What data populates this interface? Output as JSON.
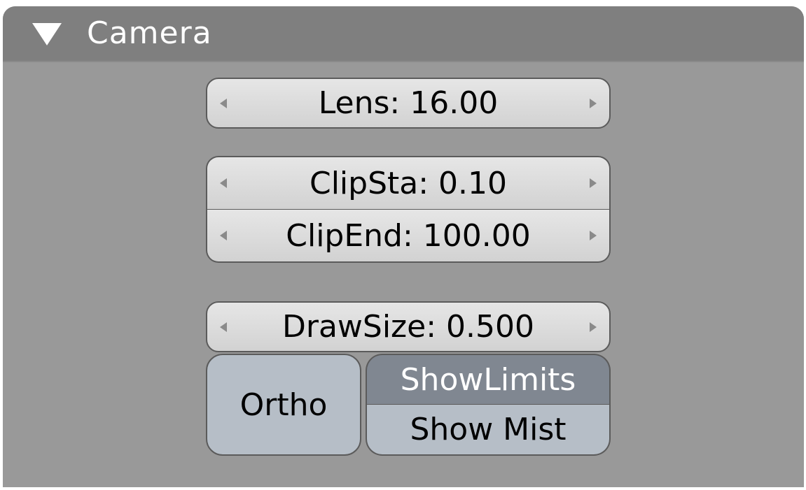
{
  "panel": {
    "title": "Camera",
    "collapse_icon": "triangle-down-icon"
  },
  "fields": {
    "lens": "Lens: 16.00",
    "clip_start": "ClipSta: 0.10",
    "clip_end": "ClipEnd: 100.00",
    "draw_size": "DrawSize: 0.500"
  },
  "toggles": {
    "ortho": {
      "label": "Ortho",
      "active": false
    },
    "show_limits": {
      "label": "ShowLimits",
      "active": true
    },
    "show_mist": {
      "label": "Show Mist",
      "active": false
    }
  },
  "colors": {
    "panel_bg": "#999999",
    "header_bg": "#7f7f7f",
    "field_bg": "#d9d9d9",
    "toggle_bg": "#b6bec7",
    "toggle_active_bg": "#808791"
  }
}
